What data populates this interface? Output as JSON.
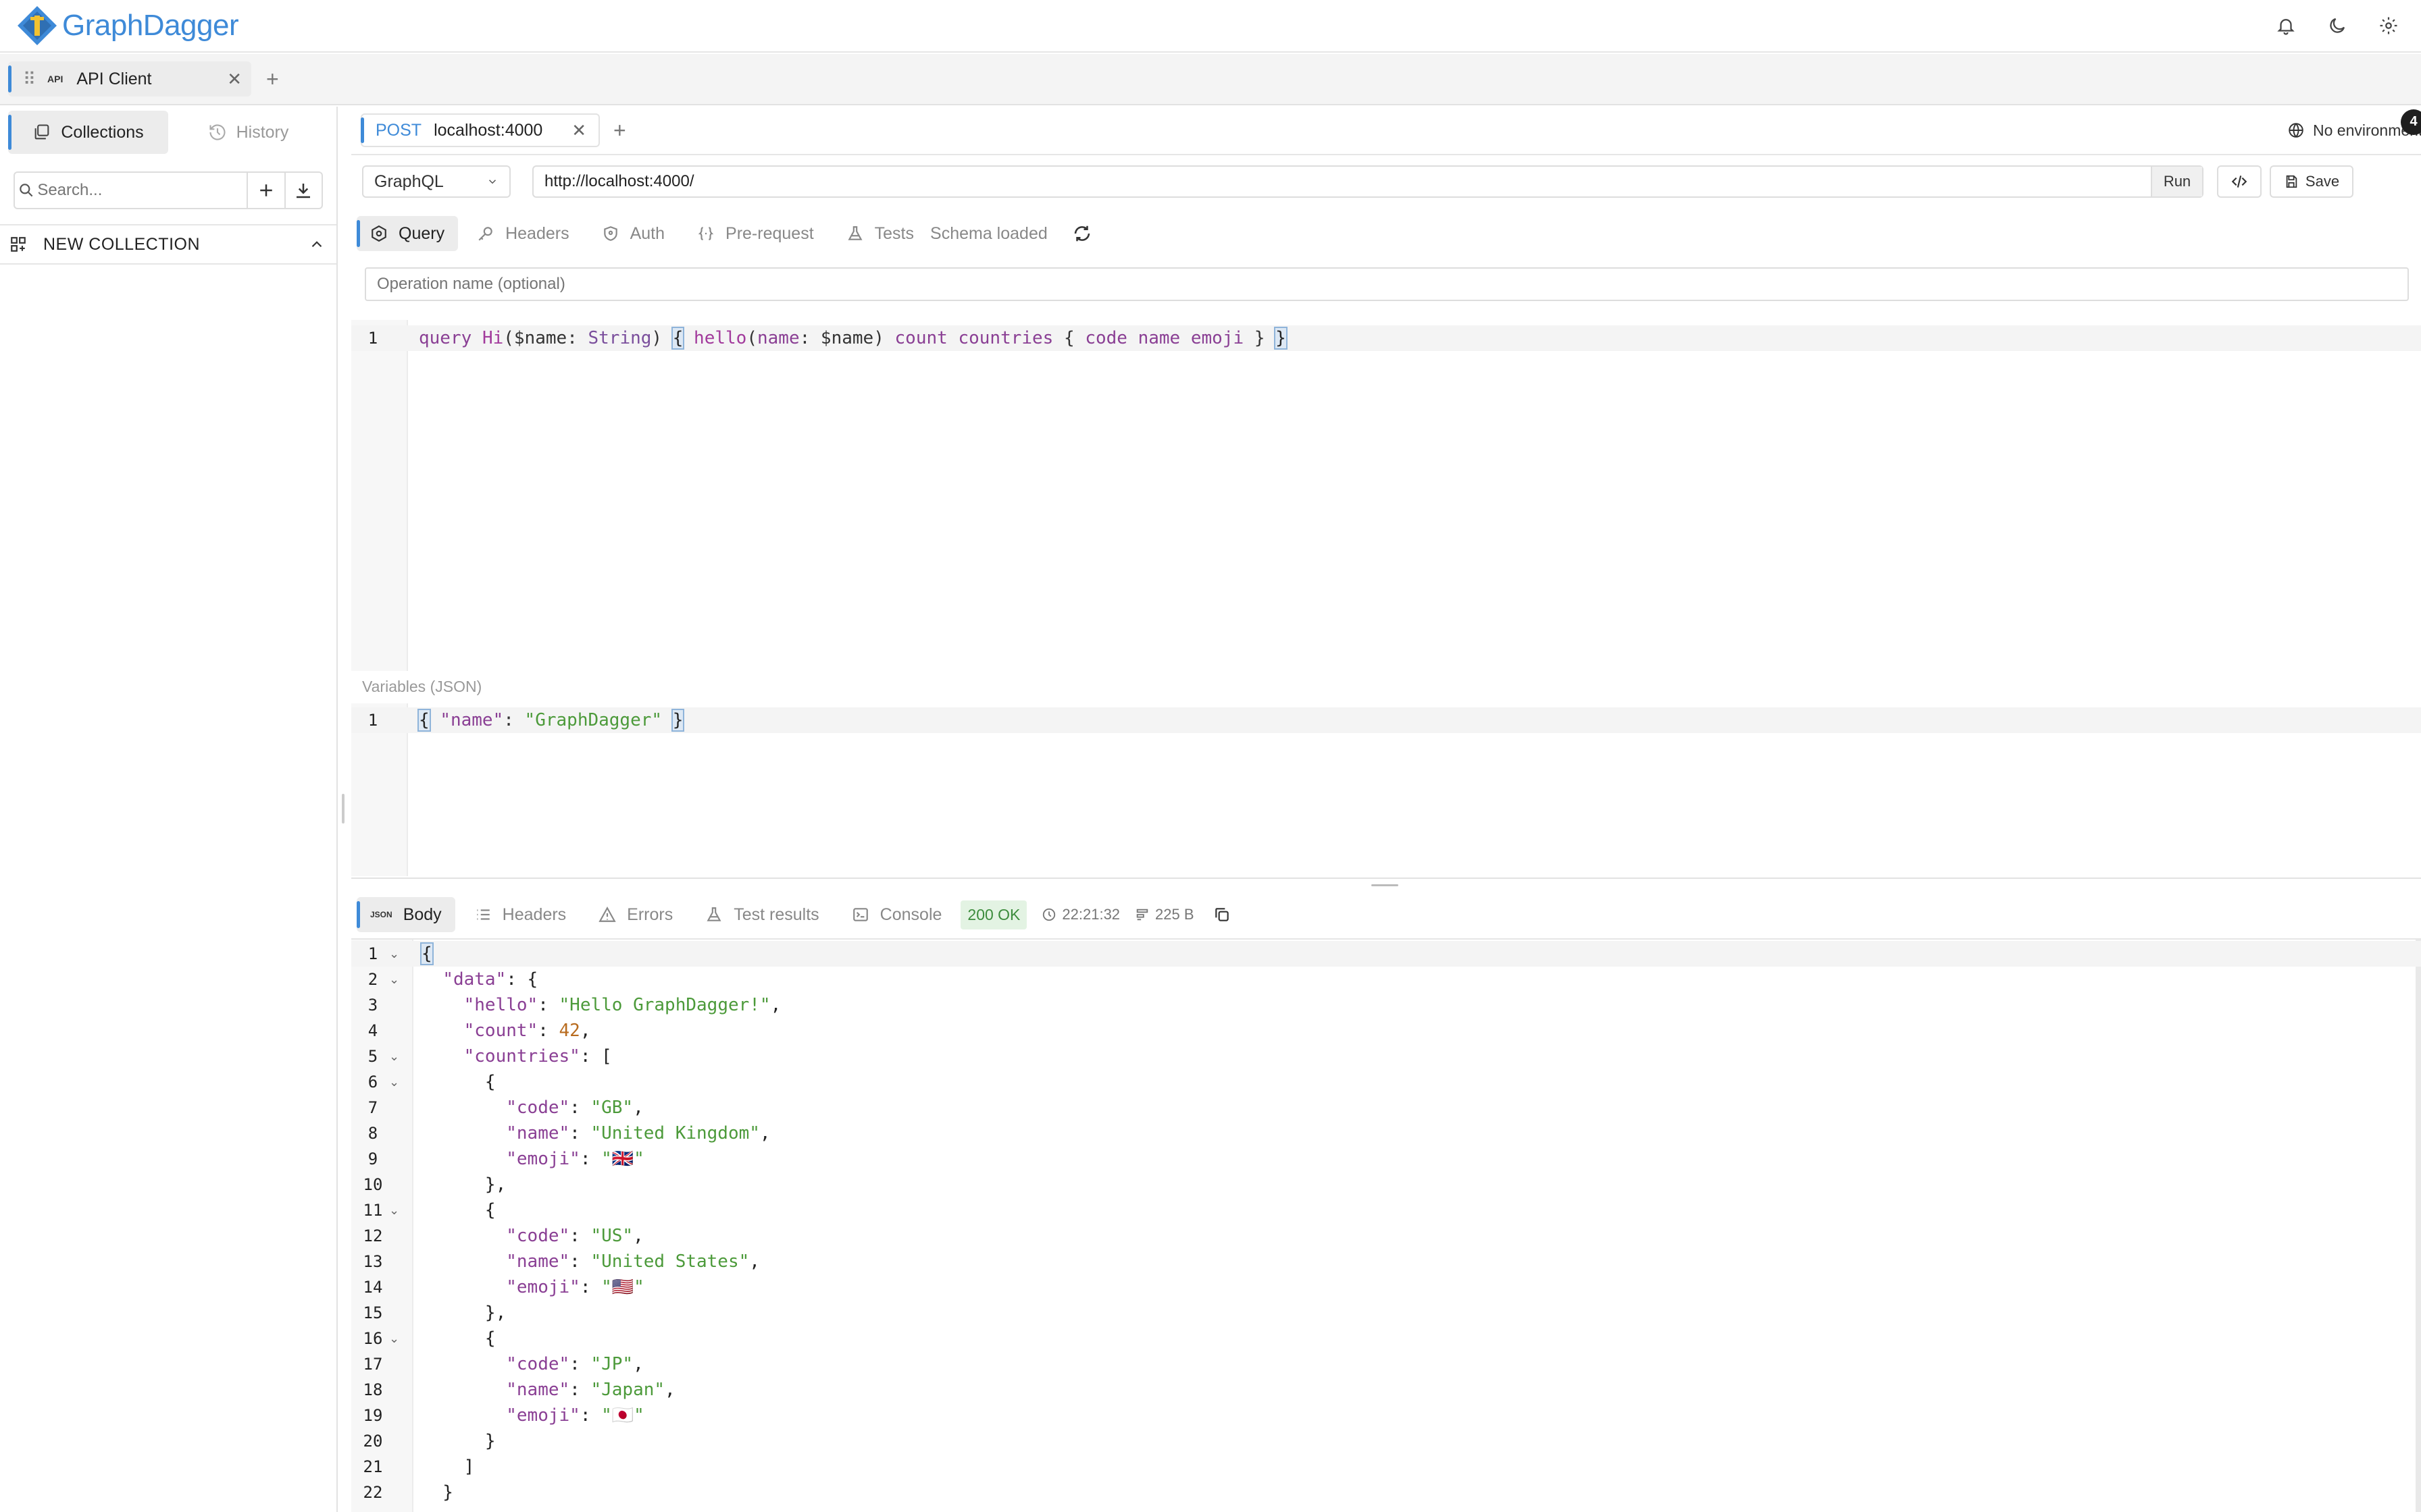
{
  "app": {
    "name": "GraphDagger"
  },
  "workspace_tabs": [
    {
      "badge": "API",
      "label": "API Client"
    }
  ],
  "sidebar": {
    "tabs": [
      {
        "label": "Collections",
        "active": true
      },
      {
        "label": "History",
        "active": false
      }
    ],
    "search_placeholder": "Search...",
    "collection": {
      "label": "NEW COLLECTION"
    }
  },
  "request_tab": {
    "method": "POST",
    "label": "localhost:4000"
  },
  "environment": {
    "label": "No environment",
    "badge": "4"
  },
  "request": {
    "protocol": "GraphQL",
    "url": "http://localhost:4000/",
    "run_label": "Run",
    "save_label": "Save"
  },
  "sub_tabs": [
    {
      "label": "Query",
      "icon": "graphql-icon",
      "active": true
    },
    {
      "label": "Headers",
      "icon": "key-icon"
    },
    {
      "label": "Auth",
      "icon": "shield-icon"
    },
    {
      "label": "Pre-request",
      "icon": "braces-icon"
    },
    {
      "label": "Tests",
      "icon": "flask-icon"
    }
  ],
  "schema_status": "Schema loaded",
  "operation_placeholder": "Operation name (optional)",
  "query_editor": {
    "line_numbers": [
      "1"
    ]
  },
  "variables": {
    "label": "Variables (JSON)",
    "line_numbers": [
      "1"
    ]
  },
  "response": {
    "tabs": [
      {
        "label": "Body",
        "icon": "json-icon",
        "active": true
      },
      {
        "label": "Headers",
        "icon": "list-icon"
      },
      {
        "label": "Errors",
        "icon": "warning-icon"
      },
      {
        "label": "Test results",
        "icon": "flask-icon"
      },
      {
        "label": "Console",
        "icon": "terminal-icon"
      }
    ],
    "status": "200 OK",
    "time": "22:21:32",
    "size": "225 B",
    "json_icon_text": "JSON",
    "line_numbers": [
      "1",
      "2",
      "3",
      "4",
      "5",
      "6",
      "7",
      "8",
      "9",
      "10",
      "11",
      "12",
      "13",
      "14",
      "15",
      "16",
      "17",
      "18",
      "19",
      "20",
      "21",
      "22"
    ]
  },
  "colors": {
    "accent": "#3e8ad8",
    "success_bg": "#e3f3e3",
    "success_fg": "#3c8c3c"
  }
}
